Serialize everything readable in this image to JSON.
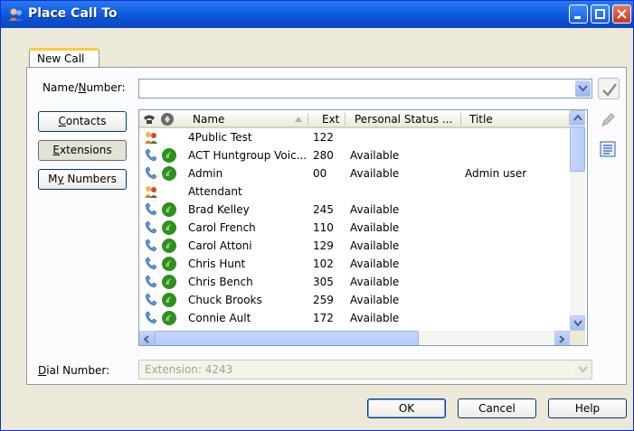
{
  "window": {
    "title": "Place Call To"
  },
  "tabs": [
    {
      "label": "New Call"
    }
  ],
  "name_number": {
    "label_prefix": "Name/",
    "label_underlined": "N",
    "label_suffix": "umber:",
    "value": ""
  },
  "side_buttons": [
    {
      "pre": "",
      "ul": "C",
      "post": "ontacts"
    },
    {
      "pre": "",
      "ul": "E",
      "post": "xtensions"
    },
    {
      "pre": "M",
      "ul": "y",
      "post": " Numbers"
    }
  ],
  "grid": {
    "columns": [
      "Name",
      "Ext",
      "Personal Status ...",
      "Title"
    ],
    "rows": [
      {
        "type": "group",
        "name": "4Public Test",
        "ext": "122",
        "status": "",
        "title": ""
      },
      {
        "type": "user",
        "name": "ACT Huntgroup Voic...",
        "ext": "280",
        "status": "Available",
        "title": ""
      },
      {
        "type": "user",
        "name": "Admin",
        "ext": "00",
        "status": "Available",
        "title": "Admin user"
      },
      {
        "type": "group",
        "name": "Attendant",
        "ext": "",
        "status": "",
        "title": ""
      },
      {
        "type": "user",
        "name": "Brad Kelley",
        "ext": "245",
        "status": "Available",
        "title": ""
      },
      {
        "type": "user",
        "name": "Carol French",
        "ext": "110",
        "status": "Available",
        "title": ""
      },
      {
        "type": "user",
        "name": "Carol Attoni",
        "ext": "129",
        "status": "Available",
        "title": ""
      },
      {
        "type": "user",
        "name": "Chris Hunt",
        "ext": "102",
        "status": "Available",
        "title": ""
      },
      {
        "type": "user",
        "name": "Chris Bench",
        "ext": "305",
        "status": "Available",
        "title": ""
      },
      {
        "type": "user",
        "name": "Chuck Brooks",
        "ext": "259",
        "status": "Available",
        "title": ""
      },
      {
        "type": "user",
        "name": "Connie Ault",
        "ext": "172",
        "status": "Available",
        "title": ""
      }
    ]
  },
  "dial_number": {
    "label_underlined": "D",
    "label_rest": "ial Number:",
    "value": "Extension: 4243"
  },
  "buttons": {
    "ok": "OK",
    "cancel": "Cancel",
    "help": "Help"
  },
  "colors": {
    "title_bar": "#0b4fd0",
    "tab_accent": "#ffc83c",
    "available_green": "#2f8f1f"
  }
}
